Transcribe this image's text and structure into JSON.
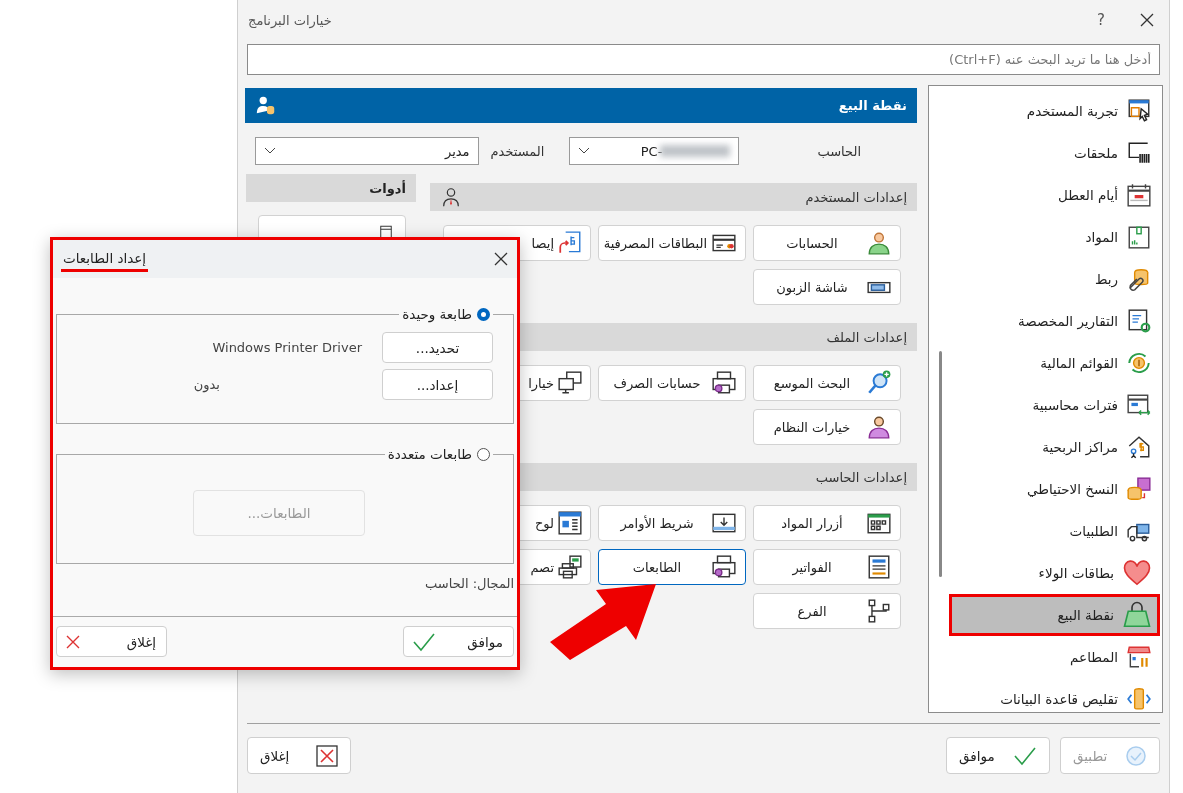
{
  "window": {
    "title": "خيارات البرنامج",
    "help": "?"
  },
  "search": {
    "placeholder": "أدخل هنا ما تريد البحث عنه (Ctrl+F)"
  },
  "sidebar": {
    "items": [
      {
        "label": "تجربة المستخدم",
        "selected": false
      },
      {
        "label": "ملحقات",
        "selected": false
      },
      {
        "label": "أيام العطل",
        "selected": false
      },
      {
        "label": "المواد",
        "selected": false
      },
      {
        "label": "ربط",
        "selected": false
      },
      {
        "label": "التقارير المخصصة",
        "selected": false
      },
      {
        "label": "القوائم المالية",
        "selected": false
      },
      {
        "label": "فترات محاسبية",
        "selected": false
      },
      {
        "label": "مراكز الربحية",
        "selected": false
      },
      {
        "label": "النسخ الاحتياطي",
        "selected": false
      },
      {
        "label": "الطلبيات",
        "selected": false
      },
      {
        "label": "بطاقات الولاء",
        "selected": false
      },
      {
        "label": "نقطة البيع",
        "selected": true
      },
      {
        "label": "المطاعم",
        "selected": false
      },
      {
        "label": "تقليص قاعدة البيانات",
        "selected": false
      }
    ]
  },
  "panel": {
    "title": "نقطة البيع",
    "computer_label": "الحاسب",
    "computer_value": "-PC",
    "user_label": "المستخدم",
    "user_value": "مدير"
  },
  "tools": {
    "title": "أدوات"
  },
  "sections": [
    {
      "title": "إعدادات المستخدم",
      "buttons": [
        {
          "label": "الحسابات",
          "focused": false
        },
        {
          "label": "البطاقات المصرفية",
          "focused": false
        },
        {
          "label": "إيصا",
          "focused": false
        },
        {
          "label": "شاشة الزبون",
          "focused": false
        }
      ]
    },
    {
      "title": "إعدادات الملف",
      "buttons": [
        {
          "label": "البحث الموسع",
          "focused": false
        },
        {
          "label": "حسابات الصرف",
          "focused": false
        },
        {
          "label": "خيارا",
          "focused": false
        },
        {
          "label": "خيارات النظام",
          "focused": false
        }
      ]
    },
    {
      "title": "إعدادات الحاسب",
      "buttons": [
        {
          "label": "أزرار المواد",
          "focused": false
        },
        {
          "label": "شريط الأوامر",
          "focused": false
        },
        {
          "label": "لوح",
          "focused": false
        },
        {
          "label": "الفواتير",
          "focused": false
        },
        {
          "label": "الطابعات",
          "focused": true
        },
        {
          "label": "تصم",
          "focused": false
        },
        {
          "label": "الفرع",
          "focused": false
        }
      ]
    }
  ],
  "footer": {
    "buttons": [
      {
        "label": "تطبيق",
        "disabled": true
      },
      {
        "label": "موافق",
        "disabled": false
      },
      {
        "label": "إغلاق",
        "disabled": false
      }
    ]
  },
  "dialog": {
    "title": "إعداد الطابعات",
    "options": [
      {
        "label": "طابعة وحيدة",
        "selected": true
      },
      {
        "label": "طابعات متعددة",
        "selected": false
      }
    ],
    "select_button": "تحديد...",
    "setup_button": "إعداد...",
    "driver": "Windows Printer Driver",
    "setup_value": "بدون",
    "printers_button": {
      "label": "الطابعات...",
      "disabled": true
    },
    "scope": "المجال: الحاسب",
    "ok": "موافق",
    "close": "إغلاق"
  }
}
